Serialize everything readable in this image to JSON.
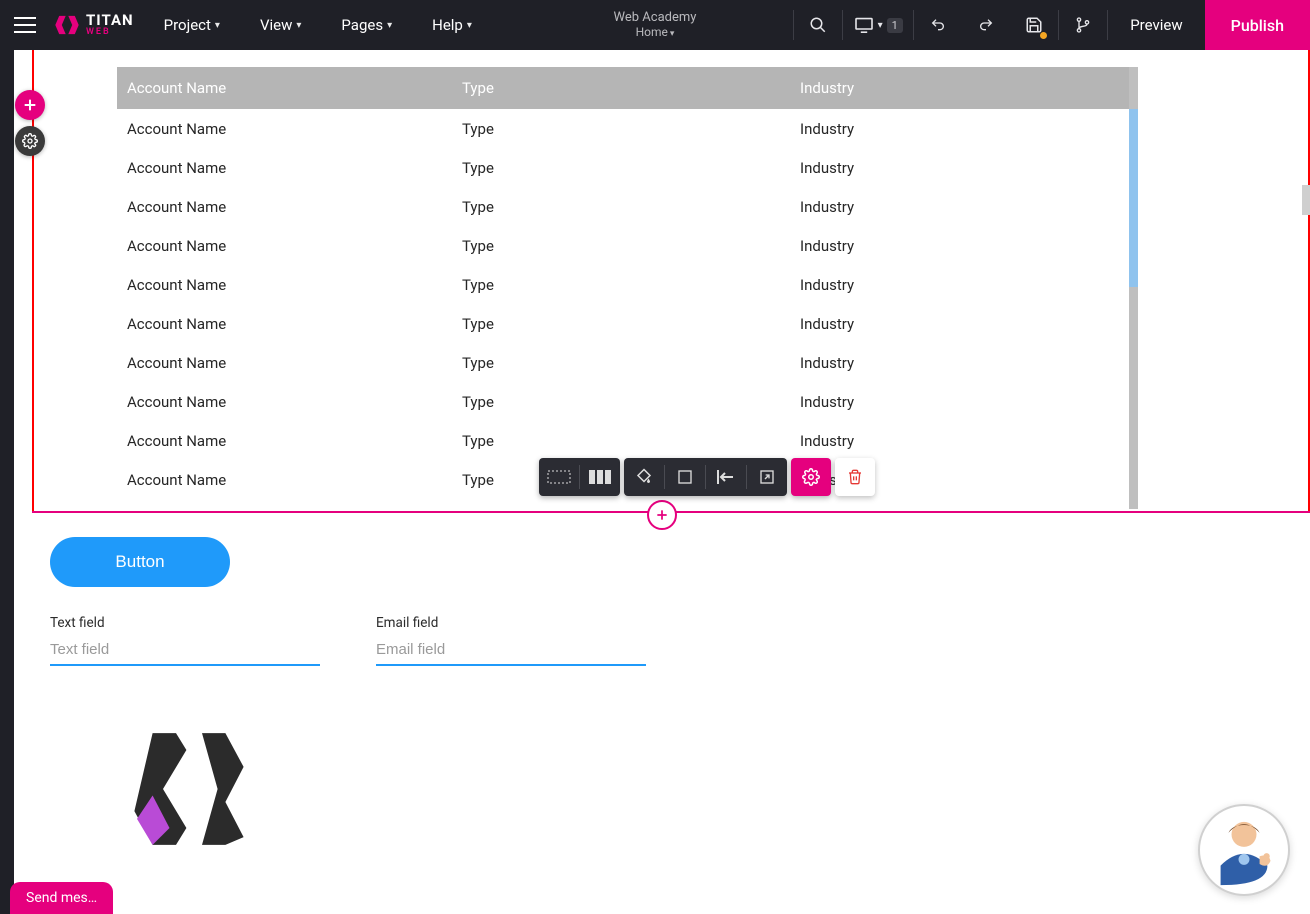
{
  "brand": {
    "name": "TITAN",
    "sub": "WEB"
  },
  "menus": {
    "project": "Project",
    "view": "View",
    "pages": "Pages",
    "help": "Help"
  },
  "site": {
    "name": "Web Academy",
    "page": "Home"
  },
  "topbar": {
    "device_badge": "1",
    "preview": "Preview",
    "publish": "Publish"
  },
  "table": {
    "headers": {
      "name": "Account Name",
      "type": "Type",
      "industry": "Industry"
    },
    "rows": [
      {
        "name": "Account Name",
        "type": "Type",
        "industry": "Industry"
      },
      {
        "name": "Account Name",
        "type": "Type",
        "industry": "Industry"
      },
      {
        "name": "Account Name",
        "type": "Type",
        "industry": "Industry"
      },
      {
        "name": "Account Name",
        "type": "Type",
        "industry": "Industry"
      },
      {
        "name": "Account Name",
        "type": "Type",
        "industry": "Industry"
      },
      {
        "name": "Account Name",
        "type": "Type",
        "industry": "Industry"
      },
      {
        "name": "Account Name",
        "type": "Type",
        "industry": "Industry"
      },
      {
        "name": "Account Name",
        "type": "Type",
        "industry": "Industry"
      },
      {
        "name": "Account Name",
        "type": "Type",
        "industry": "Industry"
      },
      {
        "name": "Account Name",
        "type": "Type",
        "industry": "Industry"
      }
    ]
  },
  "strip2": {
    "button_label": "Button",
    "text_field": {
      "label": "Text field",
      "placeholder": "Text field"
    },
    "email_field": {
      "label": "Email field",
      "placeholder": "Email field"
    }
  },
  "send_message": "Send mes…"
}
